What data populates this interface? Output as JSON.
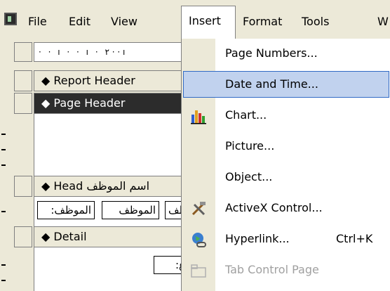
{
  "menubar": {
    "items": [
      {
        "label": "File",
        "accel": "F"
      },
      {
        "label": "Edit",
        "accel": "E"
      },
      {
        "label": "View",
        "accel": "V"
      },
      {
        "label": "Insert",
        "accel": "I"
      },
      {
        "label": "Format",
        "accel": "o"
      },
      {
        "label": "Tools",
        "accel": "T"
      },
      {
        "label": "W",
        "accel": "W"
      }
    ]
  },
  "ruler": {
    "text": "· · ı · · ı · ٢ · · ı"
  },
  "sections": {
    "report_header": "◆ Report Header",
    "page_header": "◆ Page Header",
    "group_header": "◆ Head اسم الموظف",
    "detail": "◆ Detail"
  },
  "fields": {
    "label_employee": ":الموظف",
    "field_employee": "الموظف",
    "field_employee_partial": "موظف",
    "detail_partial": ":ع"
  },
  "insert_menu": {
    "items": [
      {
        "label": "Page Numbers...",
        "shortcut": "",
        "icon": "",
        "disabled": false
      },
      {
        "label": "Date and Time...",
        "shortcut": "",
        "icon": "",
        "disabled": false,
        "highlighted": true
      },
      {
        "label": "Chart...",
        "shortcut": "",
        "icon": "chart-icon",
        "disabled": false
      },
      {
        "label": "Picture...",
        "shortcut": "",
        "icon": "",
        "disabled": false
      },
      {
        "label": "Object...",
        "shortcut": "",
        "icon": "",
        "disabled": false
      },
      {
        "label": "ActiveX Control...",
        "shortcut": "",
        "icon": "activex-tools-icon",
        "disabled": false
      },
      {
        "label": "Hyperlink...",
        "shortcut": "Ctrl+K",
        "icon": "hyperlink-globe-icon",
        "disabled": false
      },
      {
        "label": "Tab Control Page",
        "shortcut": "",
        "icon": "tab-control-icon",
        "disabled": true
      }
    ]
  },
  "colors": {
    "highlight_fill": "#c1d2ee",
    "highlight_border": "#316ac5",
    "menu_bg": "#ffffff",
    "chrome": "#ece9d8"
  }
}
